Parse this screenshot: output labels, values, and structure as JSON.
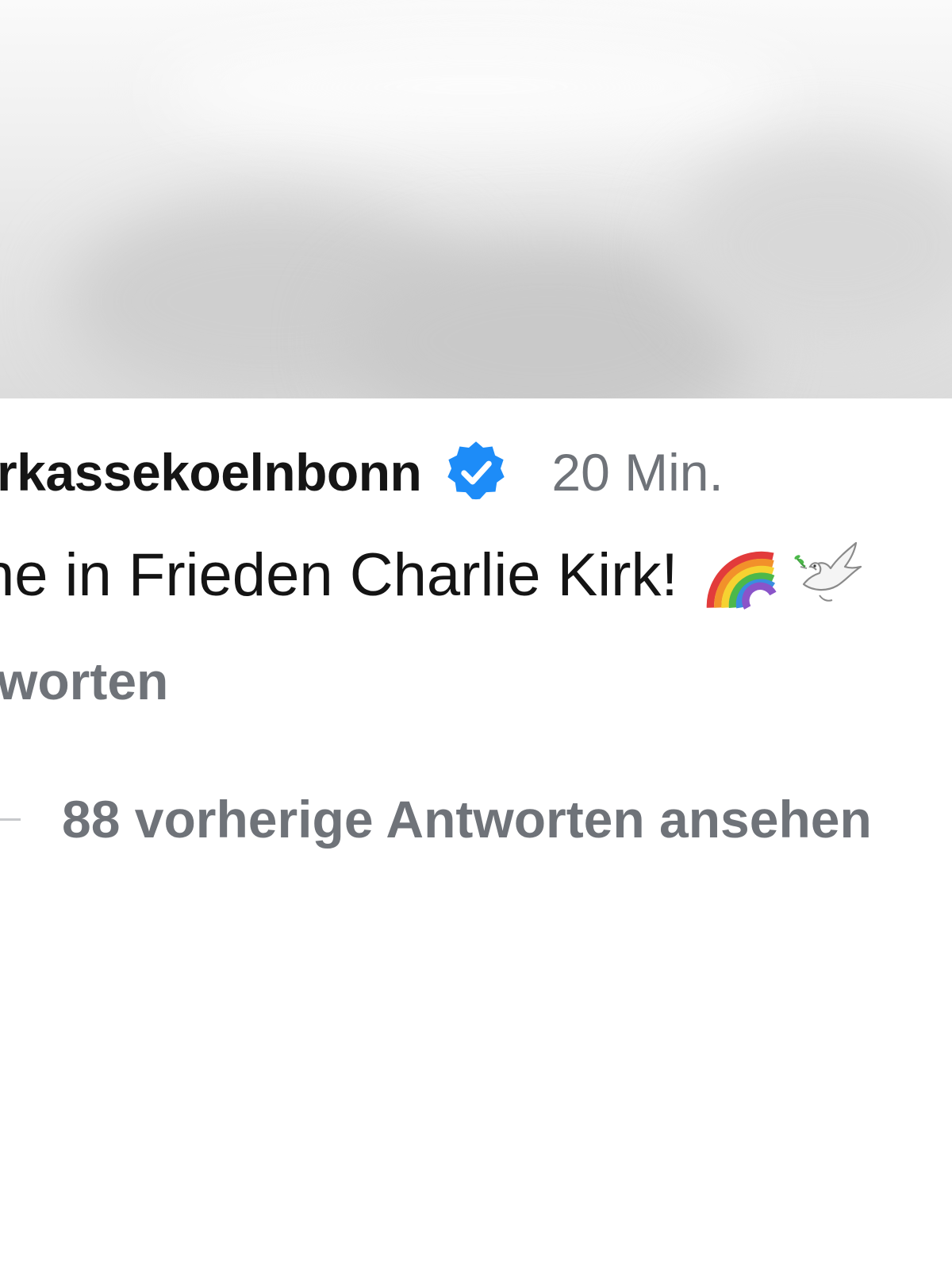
{
  "comment": {
    "username": "rkassekoelnbonn",
    "verified": true,
    "timestamp": "20 Min.",
    "text": "ne in Frieden Charlie Kirk!",
    "emojis": [
      "rainbow-icon",
      "dove-icon"
    ],
    "reply_label": "worten"
  },
  "thread": {
    "view_previous_label": "88 vorherige Antworten ansehen"
  },
  "colors": {
    "verified_blue": "#1d8cf8",
    "secondary_text": "#6f7379",
    "primary_text": "#141414"
  }
}
